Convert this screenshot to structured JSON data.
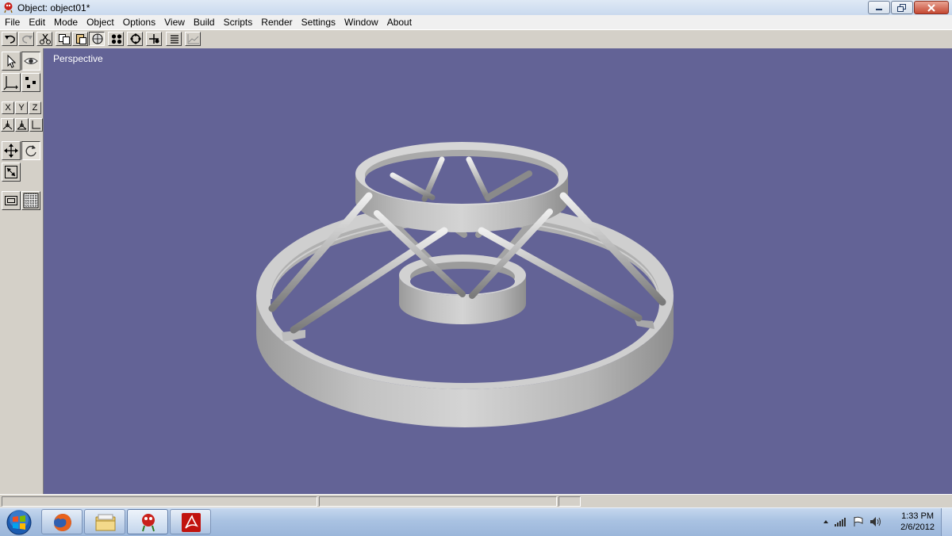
{
  "window": {
    "title": "Object: object01*"
  },
  "menu": [
    "File",
    "Edit",
    "Mode",
    "Object",
    "Options",
    "View",
    "Build",
    "Scripts",
    "Render",
    "Settings",
    "Window",
    "About"
  ],
  "axis_buttons": [
    "X",
    "Y",
    "Z"
  ],
  "viewport": {
    "label": "Perspective",
    "background": "#636396",
    "object_color": "#c4c4c4"
  },
  "taskbar": {
    "time": "1:33 PM",
    "date": "2/6/2012",
    "apps": [
      "firefox-icon",
      "explorer-folder-icon",
      "modeler-app-icon",
      "acrobat-icon"
    ]
  },
  "colors": {
    "title_bar": "#c9d9ee",
    "close_button": "#c44832",
    "panel": "#d4d0c8"
  }
}
